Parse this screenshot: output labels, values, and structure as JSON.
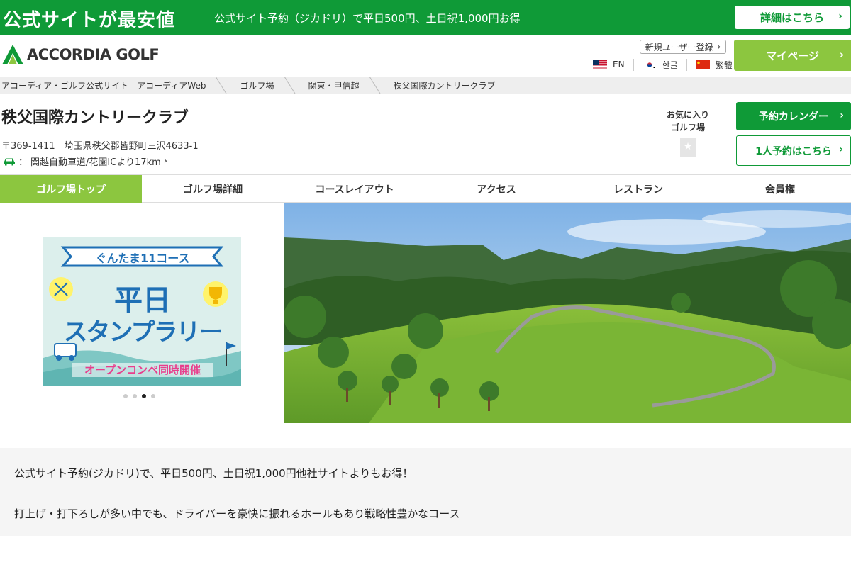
{
  "promo": {
    "title": "公式サイトが最安値",
    "description": "公式サイト予約（ジカドリ）で平日500円、土日祝1,000円お得",
    "button": "詳細はこちら"
  },
  "header": {
    "logo_text": "ACCORDIA GOLF",
    "new_user": "新規ユーザー登録",
    "mypage": "マイページ",
    "languages": [
      {
        "label": "EN",
        "flag": "us-flag-icon"
      },
      {
        "label": "한글",
        "flag": "kr-flag-icon"
      },
      {
        "label": "繁體",
        "flag": "cn-flag-icon"
      }
    ]
  },
  "breadcrumb": [
    "アコーディア・ゴルフ公式サイト　アコーディアWeb",
    "ゴルフ場",
    "関東・甲信越",
    "秩父国際カントリークラブ"
  ],
  "club": {
    "name": "秩父国際カントリークラブ",
    "address": "〒369-1411　埼玉県秩父郡皆野町三沢4633-1",
    "access": "関越自動車道/花園ICより17km",
    "favorite_label": "お気に入り\nゴルフ場",
    "calendar_button": "予約カレンダー",
    "solo_button": "1人予約はこちら"
  },
  "tabs": [
    "ゴルフ場トップ",
    "ゴルフ場詳細",
    "コースレイアウト",
    "アクセス",
    "レストラン",
    "会員権"
  ],
  "active_tab": 0,
  "banner": {
    "line1": "ぐんたま11コース",
    "line2": "平日",
    "line3": "スタンプラリー",
    "line4": "オープンコンペ同時開催"
  },
  "carousel": {
    "count": 4,
    "active": 2
  },
  "description": {
    "line1": "公式サイト予約(ジカドリ)で、平日500円、土日祝1,000円他社サイトよりもお得！",
    "line2": "打上げ・打下ろしが多い中でも、ドライバーを豪快に振れるホールもあり戦略性豊かなコース"
  },
  "colors": {
    "brand_green": "#0f9a37",
    "accent_lime": "#8cc63f",
    "banner_blue": "#1e6fb5",
    "banner_pink": "#e83e8c"
  }
}
